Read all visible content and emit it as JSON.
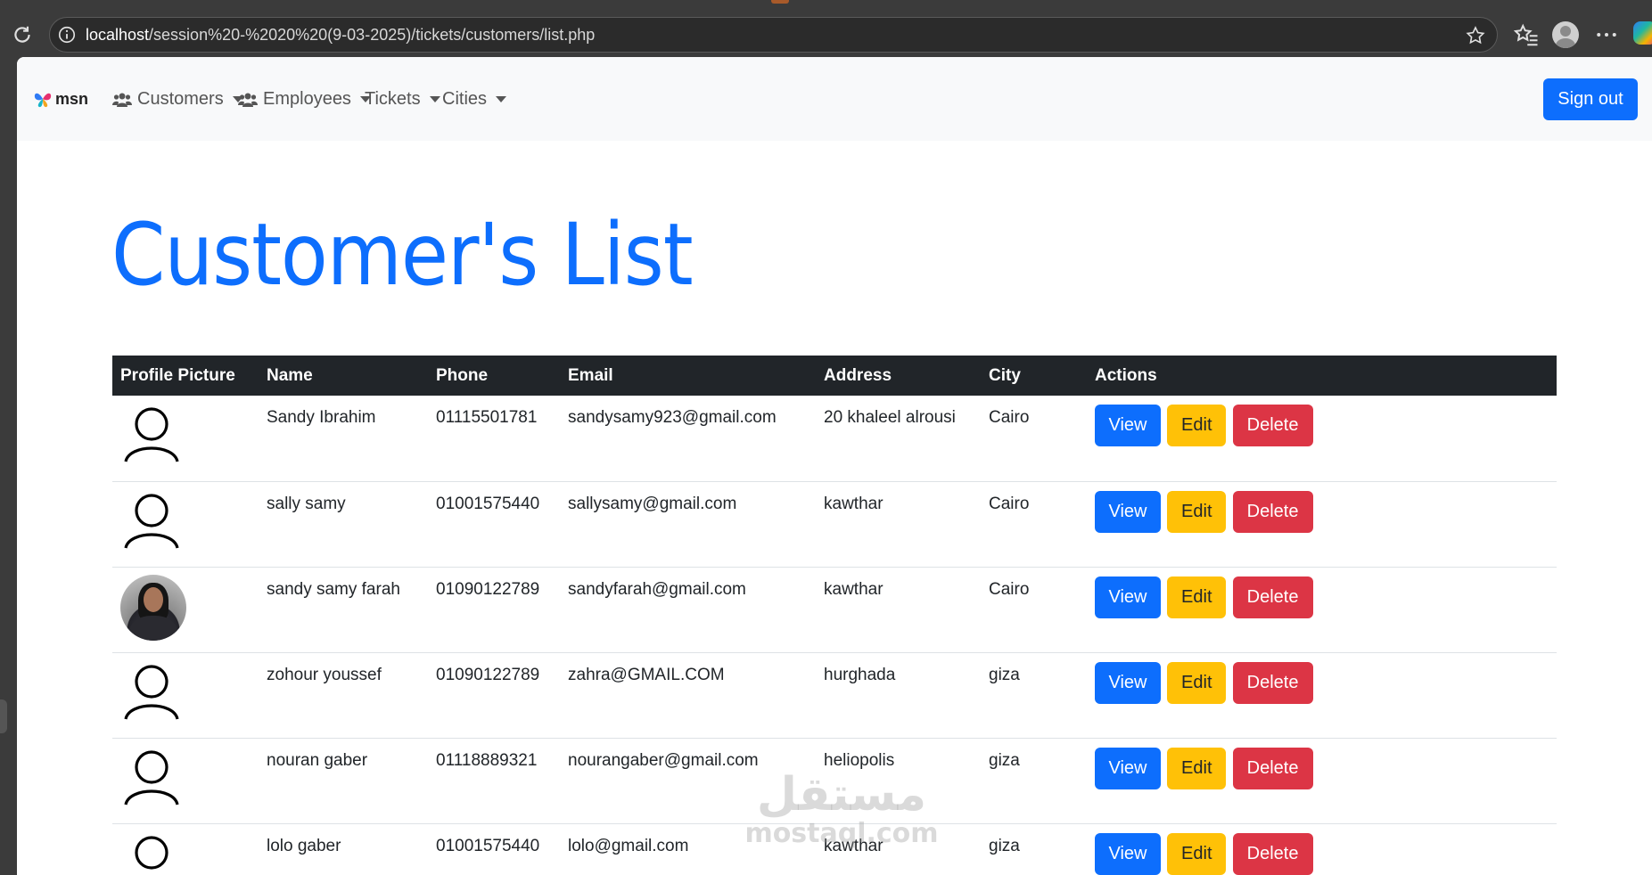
{
  "browser": {
    "url_host": "localhost",
    "url_path": "/session%20-%2020%20(9-03-2025)/tickets/customers/list.php"
  },
  "navbar": {
    "brand": "msn",
    "items": [
      {
        "label": "Customers",
        "icon": "people-icon"
      },
      {
        "label": "Employees",
        "icon": "people-icon"
      },
      {
        "label": "Tickets"
      },
      {
        "label": "Cities"
      }
    ],
    "signout_label": "Sign out"
  },
  "page": {
    "title": "Customer's List"
  },
  "table": {
    "headers": [
      "Profile Picture",
      "Name",
      "Phone",
      "Email",
      "Address",
      "City",
      "Actions"
    ],
    "rows": [
      {
        "picture": "default-avatar-icon",
        "name": "Sandy Ibrahim",
        "phone": "01115501781",
        "email": "sandysamy923@gmail.com",
        "address": "20 khaleel alrousi",
        "city": "Cairo"
      },
      {
        "picture": "default-avatar-icon",
        "name": "sally samy",
        "phone": "01001575440",
        "email": "sallysamy@gmail.com",
        "address": "kawthar",
        "city": "Cairo"
      },
      {
        "picture": "profile-photo",
        "name": "sandy samy farah",
        "phone": "01090122789",
        "email": "sandyfarah@gmail.com",
        "address": "kawthar",
        "city": "Cairo"
      },
      {
        "picture": "default-avatar-icon",
        "name": "zohour youssef",
        "phone": "01090122789",
        "email": "zahra@GMAIL.COM",
        "address": "hurghada",
        "city": "giza"
      },
      {
        "picture": "default-avatar-icon",
        "name": "nouran gaber",
        "phone": "01118889321",
        "email": "nourangaber@gmail.com",
        "address": "heliopolis",
        "city": "giza"
      },
      {
        "picture": "default-avatar-icon",
        "name": "lolo gaber",
        "phone": "01001575440",
        "email": "lolo@gmail.com",
        "address": "kawthar",
        "city": "giza"
      }
    ],
    "actions": {
      "view": "View",
      "edit": "Edit",
      "delete": "Delete"
    }
  },
  "watermark": {
    "arabic": "مستقل",
    "latin": "mostaql.com"
  },
  "colors": {
    "primary": "#0d6efd",
    "warning": "#ffc107",
    "danger": "#dc3545",
    "dark": "#212529"
  }
}
